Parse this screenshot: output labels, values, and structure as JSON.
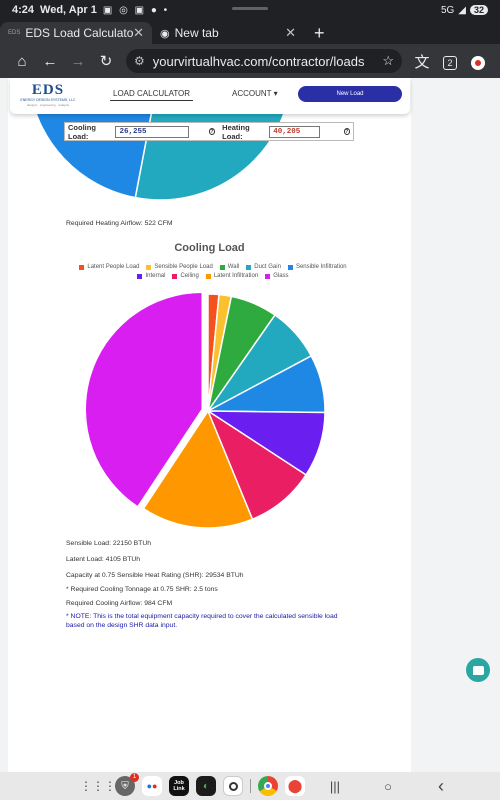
{
  "status_bar": {
    "time": "4:24",
    "date": "Wed, Apr 1",
    "notification_icons": "▣ ◎ ▣ ● •",
    "network": "5G",
    "battery": "32"
  },
  "browser": {
    "tabs": [
      {
        "favicon_text": "EDS",
        "title": "EDS Load Calculator",
        "active": true
      },
      {
        "favicon_text": "",
        "title": "New tab",
        "active": false
      }
    ],
    "new_tab_label": "+",
    "url": "yourvirtualhvac.com/contractor/loads",
    "tab_count": "2"
  },
  "nav": {
    "logo": {
      "mark": "EDS",
      "company": "ENERGY DESIGN SYSTEMS, LLC",
      "tagline": "designs · engineering · analysis"
    },
    "load_calculator": "LOAD CALCULATOR",
    "account": "ACCOUNT ▾",
    "new_load": "New Load"
  },
  "loads": {
    "cooling_label": "Cooling Load:",
    "cooling_value": "26,255",
    "heating_label": "Heating Load:",
    "heating_value": "40,205",
    "info_icon": "?"
  },
  "heating_summary": {
    "airflow": "Required Heating Airflow: 522 CFM"
  },
  "cooling_chart": {
    "title": "Cooling Load",
    "legend": [
      {
        "name": "Latent People Load",
        "color": "#f4511e"
      },
      {
        "name": "Sensible People Load",
        "color": "#fbc02d"
      },
      {
        "name": "Wall",
        "color": "#2eaa3f"
      },
      {
        "name": "Duct Gain",
        "color": "#23a9bf"
      },
      {
        "name": "Sensible Infiltration",
        "color": "#1f88e5"
      },
      {
        "name": "Internal",
        "color": "#6a1ff0"
      },
      {
        "name": "Ceiling",
        "color": "#e91e63"
      },
      {
        "name": "Latent Infiltration",
        "color": "#ff9800"
      },
      {
        "name": "Glass",
        "color": "#d81ef0"
      }
    ]
  },
  "chart_data": {
    "type": "pie",
    "title": "Cooling Load",
    "categories": [
      "Latent People Load",
      "Sensible People Load",
      "Wall",
      "Duct Gain",
      "Sensible Infiltration",
      "Internal",
      "Ceiling",
      "Latent Infiltration",
      "Glass"
    ],
    "values": [
      1.5,
      1.7,
      6.5,
      7.5,
      8.0,
      9.0,
      9.6,
      15.5,
      40.7
    ],
    "colors": [
      "#f4511e",
      "#fbc02d",
      "#2eaa3f",
      "#23a9bf",
      "#1f88e5",
      "#6a1ff0",
      "#e91e63",
      "#ff9800",
      "#d81ef0"
    ],
    "highlighted": "Glass",
    "legend_position": "top"
  },
  "top_pie": {
    "values": [
      28,
      40,
      20,
      12
    ],
    "colors": [
      "#23a9bf",
      "#1f88e5",
      "#2eaa3f",
      "#1f88e5"
    ]
  },
  "cooling_summary": {
    "sensible": "Sensible Load: 22150 BTUh",
    "latent": "Latent Load: 4105 BTUh",
    "capacity": "Capacity at 0.75 Sensible Heat Rating (SHR): 29534 BTUh",
    "tonnage": "* Required Cooling Tonnage at 0.75 SHR: 2.5 tons",
    "airflow": "Required Cooling Airflow: 984 CFM",
    "note": "* NOTE: This is the total equipment capacity required to cover the calculated sensible load based on the design SHR data input."
  },
  "taskbar": {
    "apps_icon": "⋮⋮⋮",
    "badge": "1",
    "joblink": "Job Link",
    "nav_recent": "|||",
    "nav_home": "○",
    "nav_back": "‹"
  }
}
